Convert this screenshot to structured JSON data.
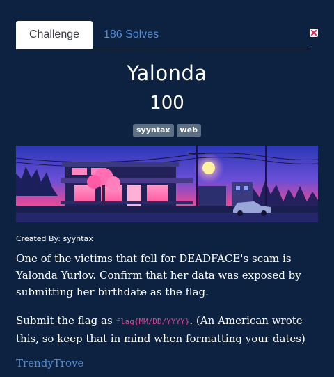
{
  "tabs": {
    "challenge_label": "Challenge",
    "solves_label": "186 Solves"
  },
  "challenge": {
    "name": "Yalonda",
    "points": "100",
    "tags": [
      "syyntax",
      "web"
    ],
    "created_by": "Created By: syyntax",
    "description_p1": "One of the victims that fell for DEADFACE's scam is Yalonda Yurlov. Confirm that her data was exposed by submitting her birthdate as the flag.",
    "description_p2_before": "Submit the flag as ",
    "flag_format": "flag{MM/DD/YYYY}",
    "description_p2_after": ". (An American wrote this, so keep that in mind when formatting your dates)",
    "link_text": "TrendyTrove"
  },
  "icons": {
    "close": "close-icon",
    "banner": "storefront-image"
  },
  "colors": {
    "background": "#0d2140",
    "link": "#4f8fd9",
    "code": "#e0468d",
    "tag": "#5d6f85",
    "close": "#e0245e"
  }
}
